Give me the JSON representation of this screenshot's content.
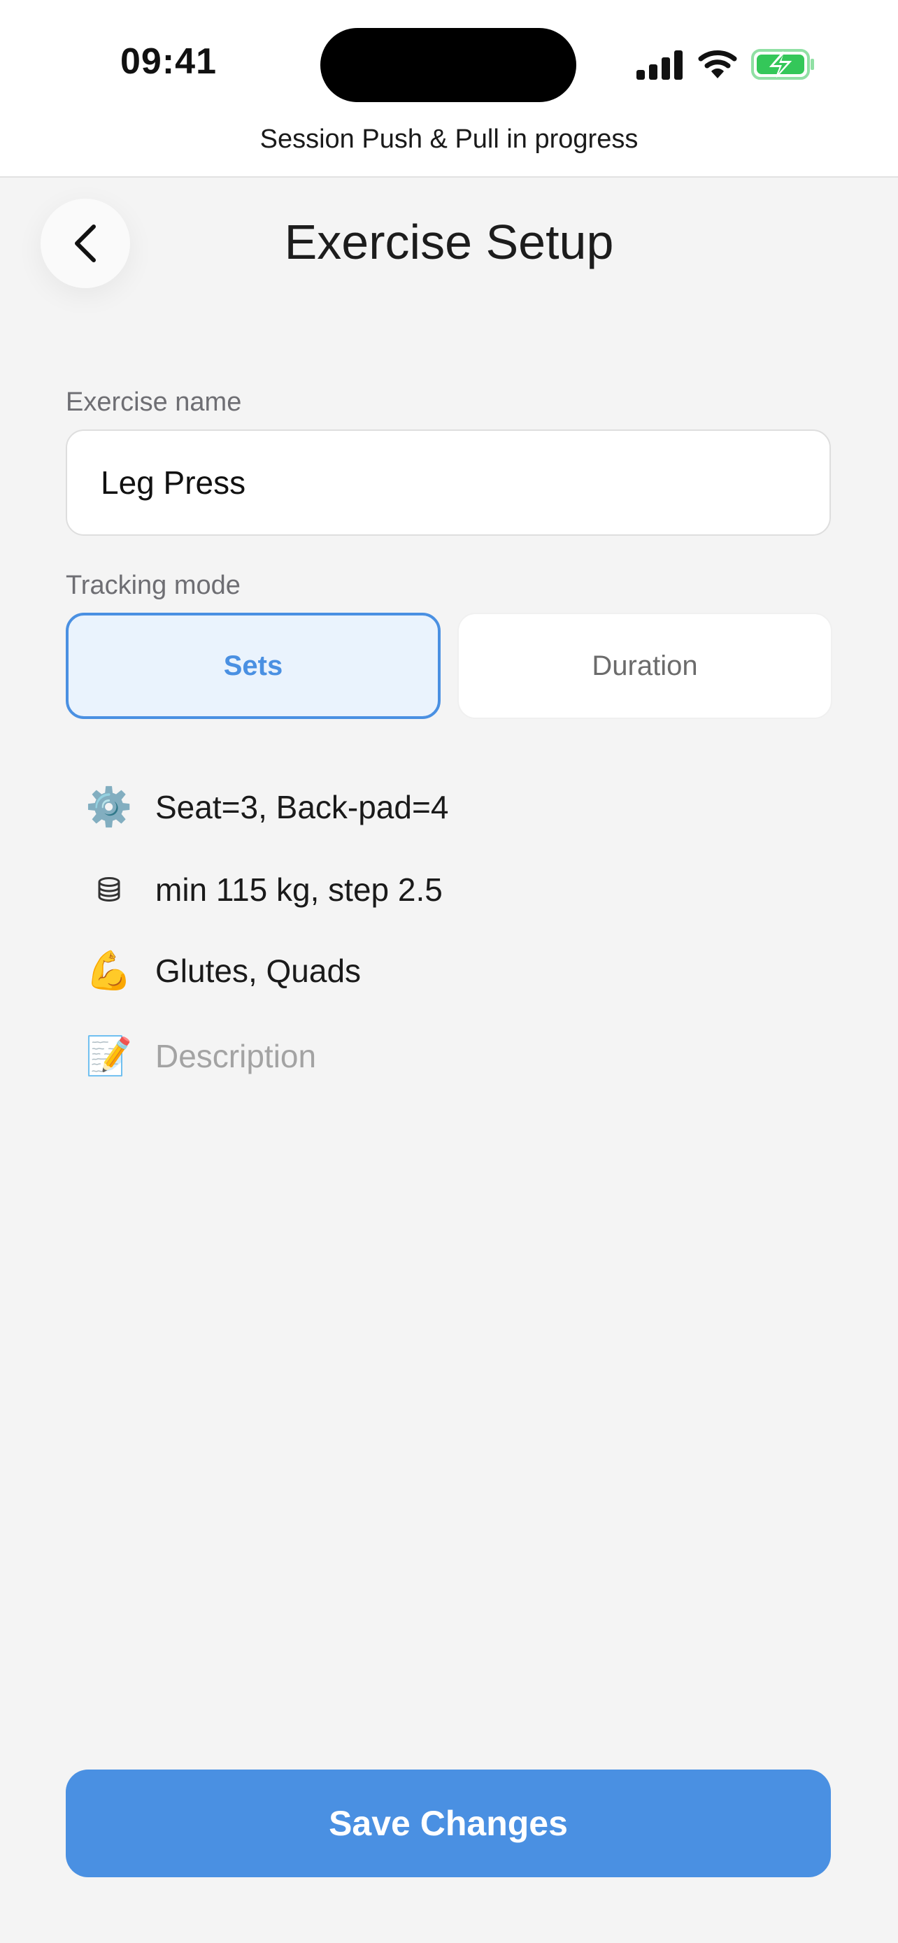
{
  "status_bar": {
    "time": "09:41",
    "signal_icon": "cellular-signal-icon",
    "wifi_icon": "wifi-icon",
    "battery_icon": "battery-charging-icon",
    "battery_color": "#34c759"
  },
  "session_banner": "Session Push & Pull in progress",
  "header": {
    "back_icon": "chevron-left-icon",
    "title": "Exercise Setup"
  },
  "form": {
    "name_label": "Exercise name",
    "name_value": "Leg Press",
    "tracking_label": "Tracking mode",
    "modes": [
      {
        "label": "Sets",
        "selected": true
      },
      {
        "label": "Duration",
        "selected": false
      }
    ]
  },
  "details": [
    {
      "icon": "gear-icon",
      "glyph": "⚙️",
      "text": "Seat=3, Back-pad=4"
    },
    {
      "icon": "weight-stack-icon",
      "glyph": "⛁",
      "text": "min 115 kg, step 2.5"
    },
    {
      "icon": "flexed-biceps-icon",
      "glyph": "💪",
      "text": "Glutes, Quads"
    },
    {
      "icon": "memo-icon",
      "glyph": "📝",
      "text": "Description"
    }
  ],
  "save_label": "Save Changes",
  "colors": {
    "accent": "#4a90e2",
    "selected_bg": "#eaf3fd",
    "background": "#f4f4f4"
  }
}
